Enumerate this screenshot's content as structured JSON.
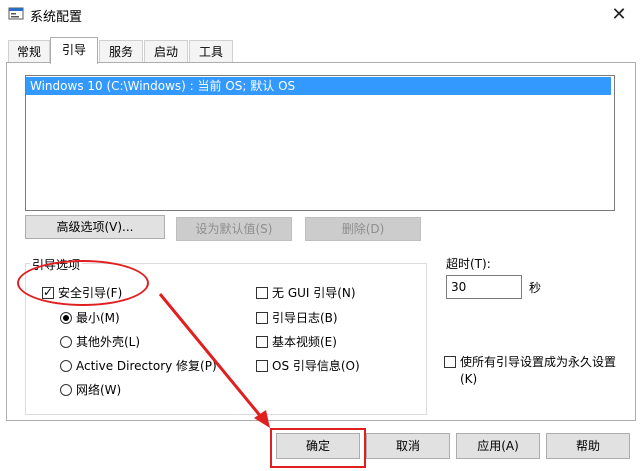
{
  "window": {
    "title": "系统配置",
    "close_glyph": "✕"
  },
  "tabs": [
    {
      "label": "常规"
    },
    {
      "label": "引导"
    },
    {
      "label": "服务"
    },
    {
      "label": "启动"
    },
    {
      "label": "工具"
    }
  ],
  "active_tab": "引导",
  "os_list": {
    "items": [
      "Windows 10 (C:\\Windows) : 当前 OS; 默认 OS"
    ],
    "selected_index": 0
  },
  "buttons": {
    "advanced": "高级选项(V)...",
    "set_default": "设为默认值(S)",
    "delete": "删除(D)"
  },
  "boot_options": {
    "title": "引导选项",
    "safe_boot": {
      "label": "安全引导(F)",
      "checked": true
    },
    "modes": [
      {
        "label": "最小(M)",
        "checked": true
      },
      {
        "label": "其他外壳(L)",
        "checked": false
      },
      {
        "label": "Active Directory 修复(P)",
        "checked": false
      },
      {
        "label": "网络(W)",
        "checked": false
      }
    ],
    "extra": [
      {
        "label": "无 GUI 引导(N)",
        "checked": false
      },
      {
        "label": "引导日志(B)",
        "checked": false
      },
      {
        "label": "基本视频(E)",
        "checked": false
      },
      {
        "label": "OS 引导信息(O)",
        "checked": false
      }
    ]
  },
  "timeout": {
    "label": "超时(T):",
    "value": "30",
    "unit": "秒"
  },
  "permanent": {
    "line1": "使所有引导设置成为永久设置",
    "line2": "(K)",
    "checked": false
  },
  "footer": {
    "ok": "确定",
    "cancel": "取消",
    "apply": "应用(A)",
    "help": "帮助"
  },
  "colors": {
    "selection": "#3399ff",
    "annotation": "#e02020"
  }
}
